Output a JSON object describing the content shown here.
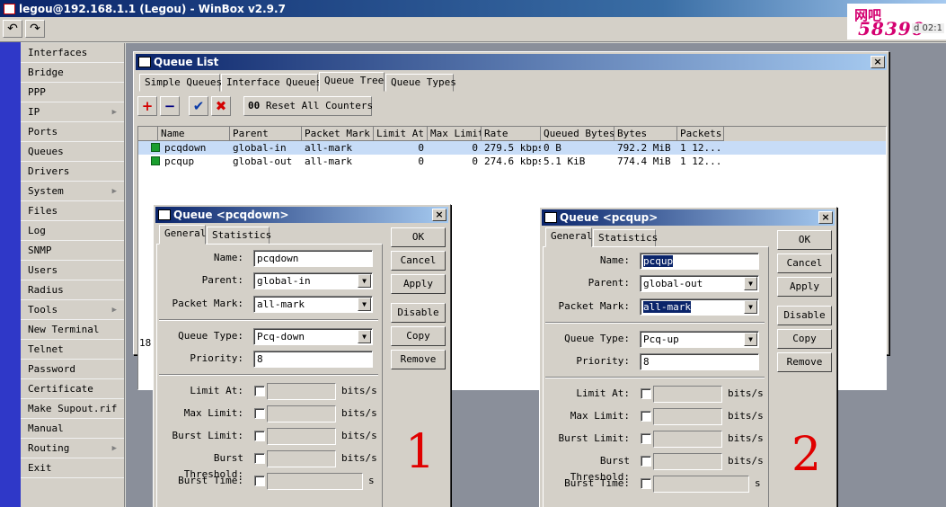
{
  "app": {
    "title": "legou@192.168.1.1 (Legou) - WinBox v2.9.7"
  },
  "toolbar": {
    "undo_glyph": "↶",
    "redo_glyph": "↷"
  },
  "watermark": {
    "text": "网吧",
    "num": "58390",
    "ext": "d 02:1"
  },
  "sidebar": {
    "items": [
      {
        "label": "Interfaces",
        "arrow": false
      },
      {
        "label": "Bridge",
        "arrow": false
      },
      {
        "label": "PPP",
        "arrow": false
      },
      {
        "label": "IP",
        "arrow": true
      },
      {
        "label": "Ports",
        "arrow": false
      },
      {
        "label": "Queues",
        "arrow": false
      },
      {
        "label": "Drivers",
        "arrow": false
      },
      {
        "label": "System",
        "arrow": true
      },
      {
        "label": "Files",
        "arrow": false
      },
      {
        "label": "Log",
        "arrow": false
      },
      {
        "label": "SNMP",
        "arrow": false
      },
      {
        "label": "Users",
        "arrow": false
      },
      {
        "label": "Radius",
        "arrow": false
      },
      {
        "label": "Tools",
        "arrow": true
      },
      {
        "label": "New Terminal",
        "arrow": false
      },
      {
        "label": "Telnet",
        "arrow": false
      },
      {
        "label": "Password",
        "arrow": false
      },
      {
        "label": "Certificate",
        "arrow": false
      },
      {
        "label": "Make Supout.rif",
        "arrow": false
      },
      {
        "label": "Manual",
        "arrow": false
      },
      {
        "label": "Routing",
        "arrow": true
      },
      {
        "label": "Exit",
        "arrow": false
      }
    ],
    "arrow_glyph": "▶"
  },
  "queue_list": {
    "title": "Queue List",
    "close": "×",
    "tabs": [
      "Simple Queues",
      "Interface Queues",
      "Queue Tree",
      "Queue Types"
    ],
    "active_tab": 2,
    "buttons": {
      "add": "+",
      "remove": "−",
      "enable": "✔",
      "disable": "✖",
      "reset_counters": "Reset All Counters",
      "reset_icon": "00"
    },
    "columns": [
      "Name",
      "Parent",
      "Packet Mark",
      "Limit At",
      "Max Limit",
      "Rate",
      "Queued Bytes",
      "Bytes",
      "Packets"
    ],
    "rows": [
      {
        "name": "pcqdown",
        "parent": "global-in",
        "packet_mark": "all-mark",
        "limit_at": "0",
        "max_limit": "0",
        "rate": "279.5 kbps",
        "queued_bytes": "0 B",
        "bytes": "792.2 MiB",
        "packets": "1 12...",
        "selected": true
      },
      {
        "name": "pcqup",
        "parent": "global-out",
        "packet_mark": "all-mark",
        "limit_at": "0",
        "max_limit": "0",
        "rate": "274.6 kbps",
        "queued_bytes": "5.1 KiB",
        "bytes": "774.4 MiB",
        "packets": "1 12...",
        "selected": false
      }
    ],
    "status_count": "18"
  },
  "dialog_down": {
    "title": "Queue <pcqdown>",
    "tabs": [
      "General",
      "Statistics"
    ],
    "name_label": "Name:",
    "name": "pcqdown",
    "parent_label": "Parent:",
    "parent": "global-in",
    "packet_mark_label": "Packet Mark:",
    "packet_mark": "all-mark",
    "queue_type_label": "Queue Type:",
    "queue_type": "Pcq-down",
    "priority_label": "Priority:",
    "priority": "8",
    "limit_at_label": "Limit At:",
    "max_limit_label": "Max Limit:",
    "burst_limit_label": "Burst Limit:",
    "burst_threshold_label": "Burst Threshold:",
    "burst_time_label": "Burst Time:",
    "unit_bits": "bits/s",
    "unit_s": "s",
    "buttons": [
      "OK",
      "Cancel",
      "Apply",
      "Disable",
      "Copy",
      "Remove"
    ],
    "annotation": "1"
  },
  "dialog_up": {
    "title": "Queue <pcqup>",
    "tabs": [
      "General",
      "Statistics"
    ],
    "name_label": "Name:",
    "name": "pcqup",
    "parent_label": "Parent:",
    "parent": "global-out",
    "packet_mark_label": "Packet Mark:",
    "packet_mark": "all-mark",
    "queue_type_label": "Queue Type:",
    "queue_type": "Pcq-up",
    "priority_label": "Priority:",
    "priority": "8",
    "limit_at_label": "Limit At:",
    "max_limit_label": "Max Limit:",
    "burst_limit_label": "Burst Limit:",
    "burst_threshold_label": "Burst Threshold:",
    "burst_time_label": "Burst Time:",
    "unit_bits": "bits/s",
    "unit_s": "s",
    "buttons": [
      "OK",
      "Cancel",
      "Apply",
      "Disable",
      "Copy",
      "Remove"
    ],
    "annotation": "2"
  },
  "colors": {
    "sidebar_strip": "#2f38c8",
    "title_gradient_start": "#0a246a",
    "annotation_red": "#e00000",
    "row_selected": "#c7dcf7"
  }
}
